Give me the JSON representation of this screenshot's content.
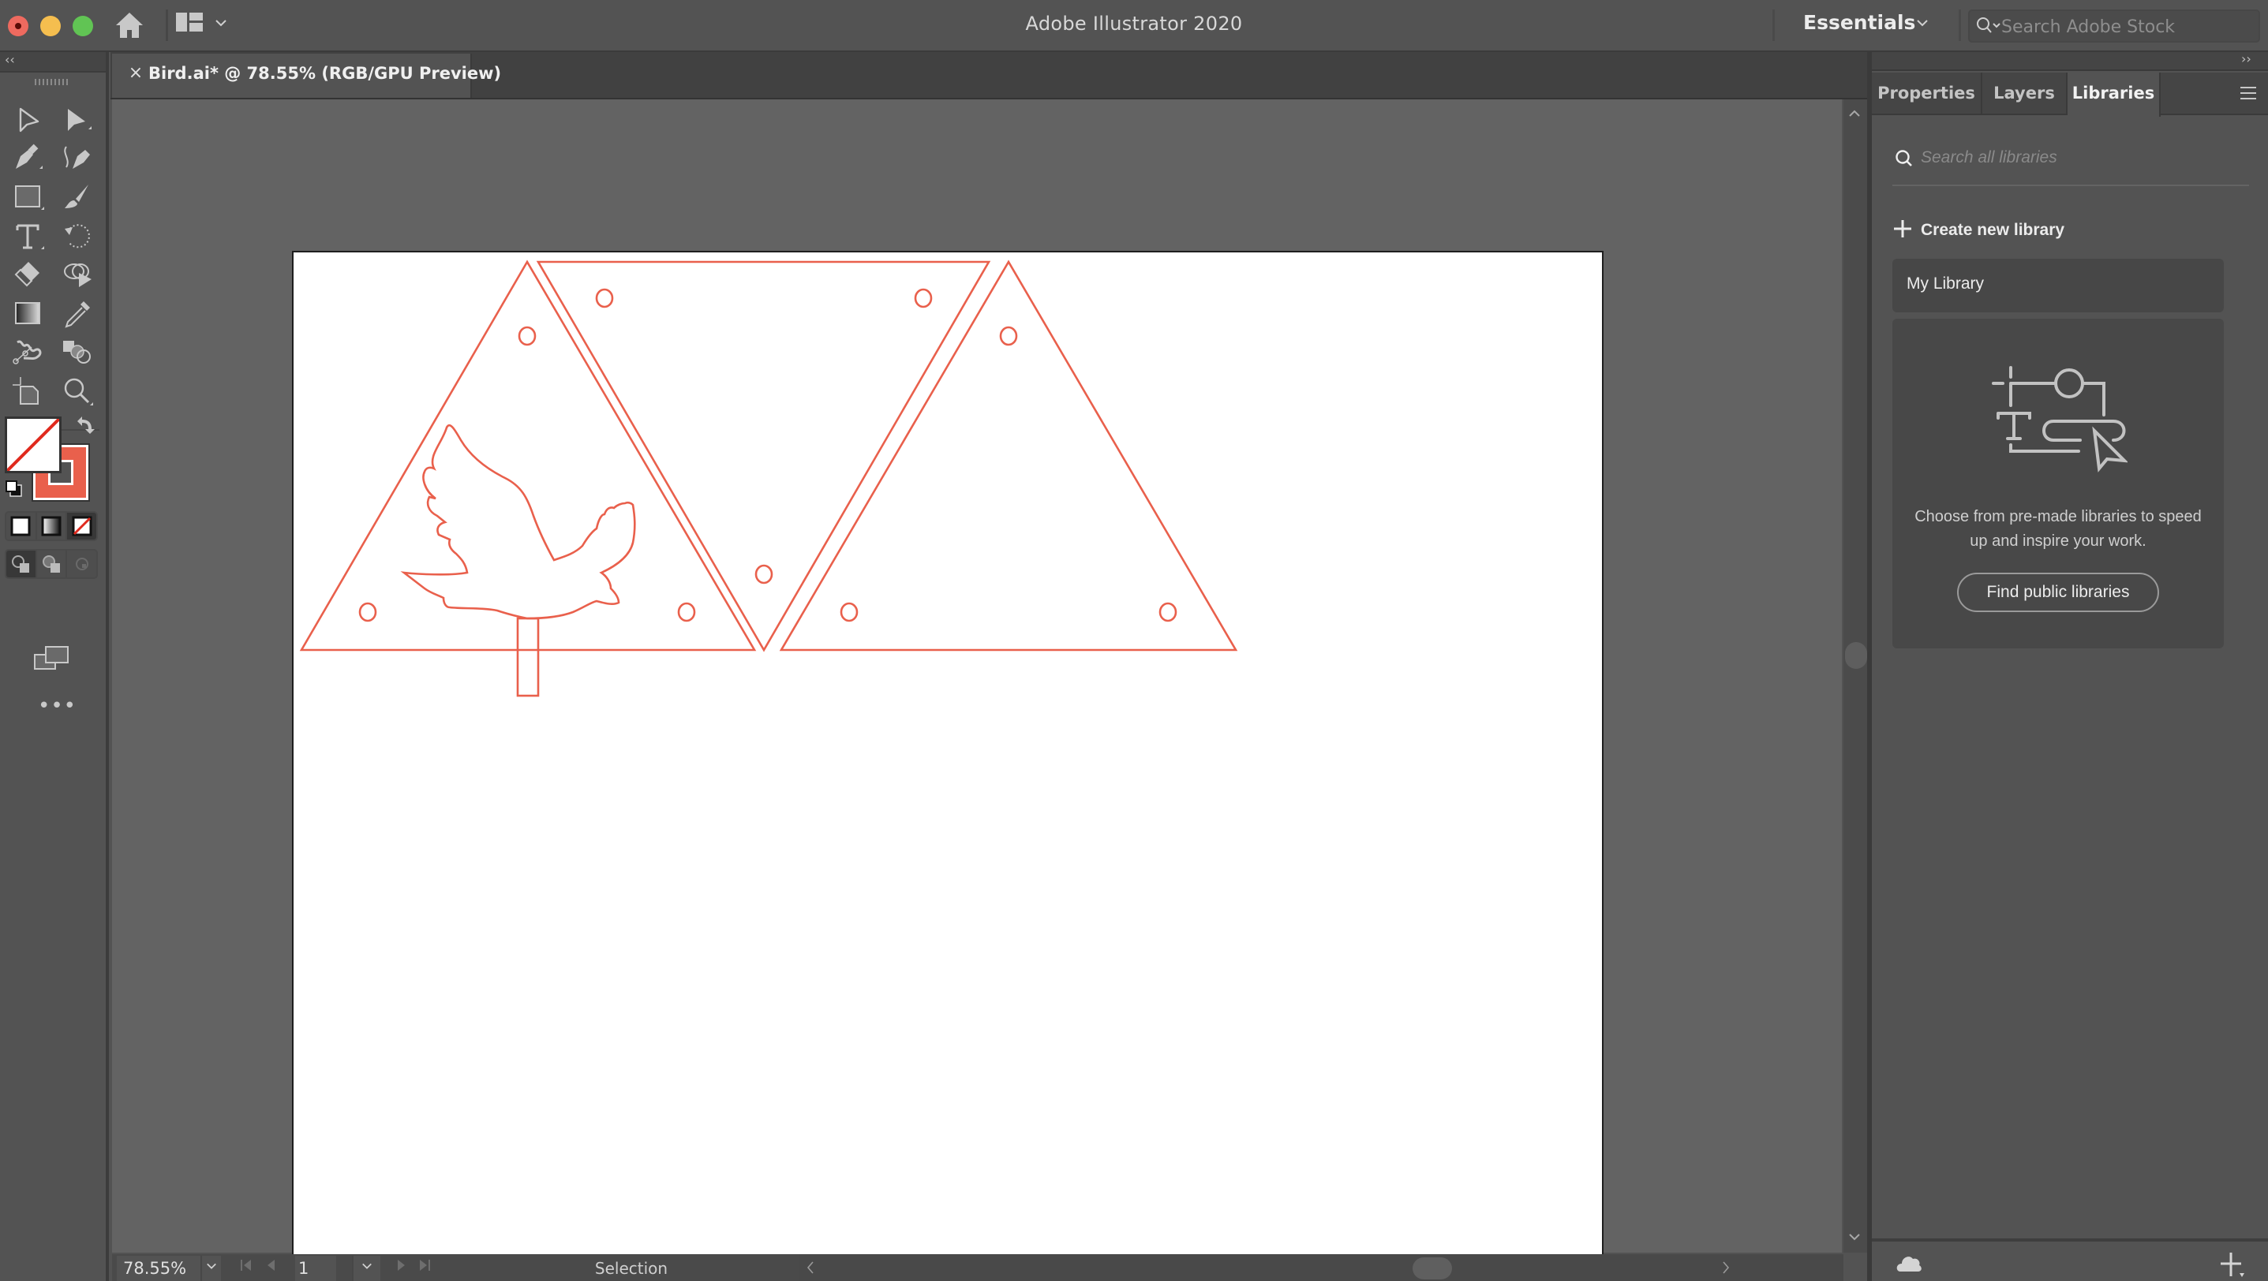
{
  "titlebar": {
    "app_title": "Adobe Illustrator 2020",
    "workspace": "Essentials",
    "stock_search_placeholder": "Search Adobe Stock",
    "icons": [
      "close-window",
      "minimize-window",
      "maximize-window",
      "home-icon",
      "workspace-layout-icon",
      "chevron-down-icon",
      "search-icon"
    ]
  },
  "document_tab": {
    "close_glyph": "×",
    "label": "Bird.ai* @ 78.55% (RGB/GPU Preview)"
  },
  "toolbar": {
    "collapse_glyph": "‹‹",
    "tools": [
      {
        "name": "selection-tool"
      },
      {
        "name": "direct-selection-tool"
      },
      {
        "name": "pen-tool"
      },
      {
        "name": "curvature-tool"
      },
      {
        "name": "rectangle-tool"
      },
      {
        "name": "paintbrush-tool"
      },
      {
        "name": "type-tool"
      },
      {
        "name": "rotate-tool"
      },
      {
        "name": "eraser-tool"
      },
      {
        "name": "shape-builder-tool"
      },
      {
        "name": "gradient-tool"
      },
      {
        "name": "eyedropper-tool"
      },
      {
        "name": "puppet-warp-tool"
      },
      {
        "name": "blend-tool"
      },
      {
        "name": "artboard-tool"
      },
      {
        "name": "zoom-tool"
      }
    ],
    "fill_color": "none",
    "stroke_color": "#e9604c",
    "more_glyph": "•••"
  },
  "artwork": {
    "stroke_color": "#e9604c",
    "pieces": [
      "left-triangle-with-bird",
      "middle-inverted-triangle",
      "right-triangle"
    ]
  },
  "statusbar": {
    "zoom_value": "78.55%",
    "artboard_number": "1",
    "status_label": "Selection",
    "chevron_glyph": "⌄"
  },
  "right_panel": {
    "collapse_glyph": "››",
    "tabs": [
      {
        "label": "Properties",
        "active": false
      },
      {
        "label": "Layers",
        "active": false
      },
      {
        "label": "Libraries",
        "active": true
      }
    ],
    "search_placeholder": "Search all libraries",
    "create_library_label": "Create new library",
    "my_library_label": "My Library",
    "card_text": "Choose from pre-made libraries to speed up and inspire your work.",
    "find_public_label": "Find public libraries"
  }
}
